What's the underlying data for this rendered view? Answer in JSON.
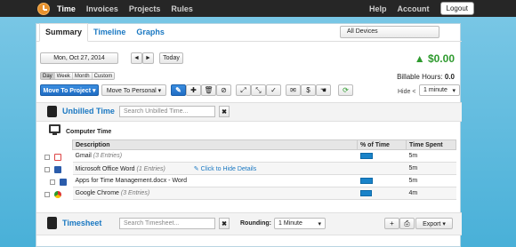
{
  "topbar": {
    "nav": [
      "Time",
      "Invoices",
      "Projects",
      "Rules"
    ],
    "right": [
      "Help",
      "Account"
    ],
    "logout": "Logout"
  },
  "tabs": [
    "Summary",
    "Timeline",
    "Graphs"
  ],
  "devices": "All Devices",
  "date": {
    "label": "Mon, Oct 27, 2014",
    "prev": "◄",
    "next": "►",
    "today": "Today",
    "ranges": [
      "Day",
      "Week",
      "Month",
      "Custom"
    ]
  },
  "earnings": {
    "amount": "▲ $0.00"
  },
  "billable": {
    "label": "Billable Hours:",
    "value": "0.0"
  },
  "actions": {
    "move_project": "Move To Project ▾",
    "move_personal": "Move To Personal ▾",
    "hide_label": "Hide <",
    "hide_value": "1 minute"
  },
  "unbilled": {
    "title": "Unbilled Time",
    "search_placeholder": "Search Unbilled Time...",
    "clear": "✖",
    "group": "Computer Time",
    "headers": [
      "Description",
      "% of Time",
      "Time Spent"
    ],
    "rows": [
      {
        "app": "Gmail",
        "entries": "(3 Entries)",
        "percent": 0.55,
        "time": "5m",
        "extra": ""
      },
      {
        "app": "Microsoft Office Word",
        "entries": "(1 Entries)",
        "percent": 0,
        "time": "5m",
        "extra": "Click to Hide Details"
      },
      {
        "app": "Apps for Time Management.docx - Word",
        "entries": "",
        "percent": 0.55,
        "time": "5m",
        "extra": ""
      },
      {
        "app": "Google Chrome",
        "entries": "(3 Entries)",
        "percent": 0.5,
        "time": "4m",
        "extra": ""
      }
    ]
  },
  "timesheet": {
    "title": "Timesheet",
    "search_placeholder": "Search Timesheet...",
    "clear": "✖",
    "rounding_label": "Rounding:",
    "rounding_value": "1 Minute",
    "export": "Export ▾",
    "add": "+",
    "print": "⎙"
  },
  "colors": {
    "accent": "#1a78c2",
    "money": "#2e9a2e",
    "topbar": "#262626",
    "background": "#49b0d8"
  },
  "icons": [
    "clock-logo-icon",
    "pencil-icon",
    "plus-icon",
    "trash-icon",
    "block-icon",
    "expand-icon",
    "collapse-icon",
    "check-icon",
    "envelope-icon",
    "money-bag-icon",
    "hand-icon",
    "refresh-icon",
    "monitor-icon",
    "gmail-icon",
    "word-icon",
    "chrome-icon",
    "timesheet-icon",
    "unbilled-icon"
  ]
}
